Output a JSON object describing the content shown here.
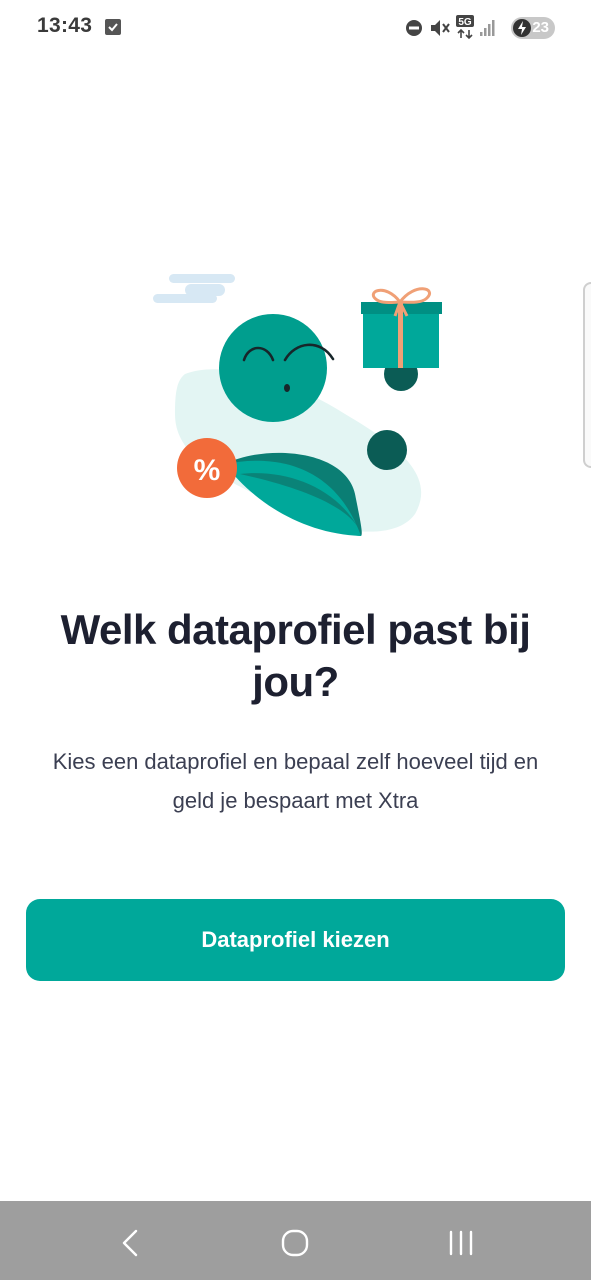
{
  "status_bar": {
    "time": "13:43",
    "network": "5G",
    "battery": "23",
    "icons": [
      "checkbox-notification-icon",
      "do-not-disturb-icon",
      "mute-icon",
      "5g-data-icon",
      "signal-icon",
      "battery-charging-icon"
    ]
  },
  "illustration": {
    "discount_symbol": "%",
    "icons": [
      "cloud-icon",
      "gift-icon",
      "avatar-person-icon",
      "discount-badge-icon"
    ],
    "colors": {
      "teal": "#00a89a",
      "dark_teal": "#0b5c55",
      "light_teal": "#e3f5f3",
      "orange": "#f26b3a",
      "cloud": "#d7e8f4"
    }
  },
  "main": {
    "headline": "Welk dataprofiel past bij jou?",
    "subtext": "Kies een dataprofiel en bepaal zelf hoeveel tijd en geld je bespaart met Xtra",
    "cta_label": "Dataprofiel kiezen"
  },
  "nav_bar": {
    "icons": [
      "back-icon",
      "home-icon",
      "recent-apps-icon"
    ]
  },
  "colors": {
    "accent": "#00a89a",
    "text_dark": "#1d2030",
    "text_body": "#3b3f52",
    "nav_bar": "#9e9e9e"
  }
}
